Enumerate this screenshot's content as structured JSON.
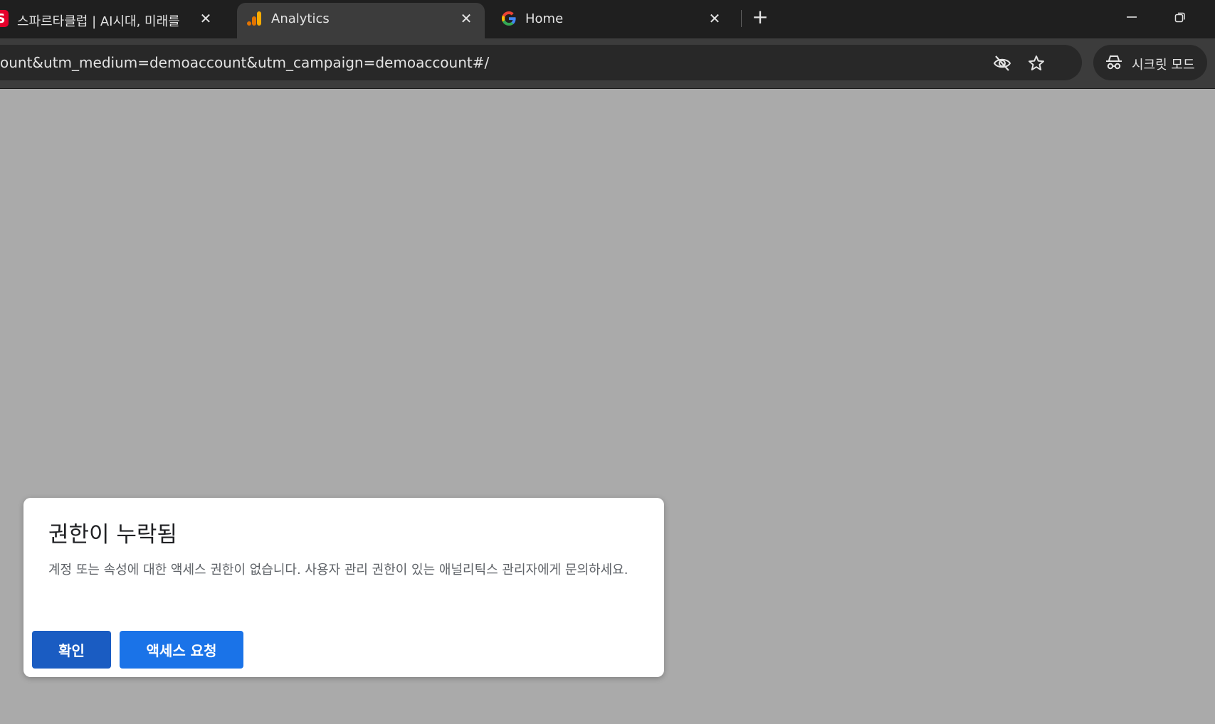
{
  "tabs": [
    {
      "title": "스파르타클럽 | AI시대, 미래를",
      "favicon": "sparta-s-icon",
      "active": false
    },
    {
      "title": "Analytics",
      "favicon": "analytics-icon",
      "active": true
    },
    {
      "title": "Home",
      "favicon": "google-icon",
      "active": false
    }
  ],
  "favicon_letter": "S",
  "new_tab_symbol": "+",
  "close_symbol": "✕",
  "toolbar": {
    "url": "ount&utm_medium=demoaccount&utm_campaign=demoaccount#/",
    "incognito_label": "시크릿 모드"
  },
  "dialog": {
    "title": "권한이 누락됨",
    "body": "계정 또는 속성에 대한 액세스 권한이 없습니다. 사용자 관리 권한이 있는 애널리틱스 관리자에게 문의하세요.",
    "ok_label": "확인",
    "request_label": "액세스 요청"
  },
  "colors": {
    "page_overlay": "#aaaaaa",
    "primary_button": "#1a73e8",
    "ok_button": "#1a5cc2",
    "analytics_orange": "#f9ab00"
  }
}
